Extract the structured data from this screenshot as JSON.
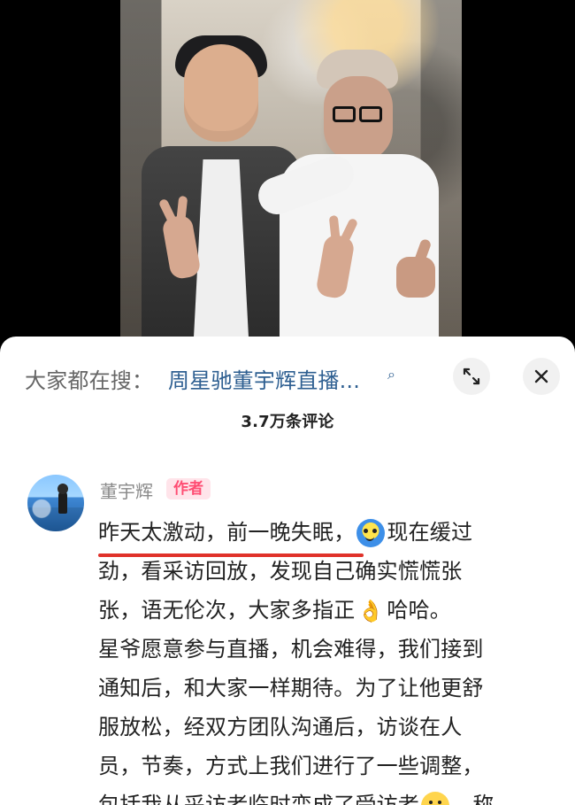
{
  "search": {
    "prefix": "大家都在搜：",
    "query": "周星驰董宇辉直播..."
  },
  "header": {
    "comment_count": "3.7万条评论"
  },
  "comment": {
    "username": "董宇辉",
    "author_tag": "作者",
    "line1a": "昨天太激动，前一晚失眠，",
    "line1b": "现在缓过",
    "line2": "劲，看采访回放，发现自己确实慌慌张",
    "line3a": "张，语无伦次，大家多指正",
    "line3b": "哈哈。",
    "line4": "星爷愿意参与直播，机会难得，我们接到",
    "line5": "通知后，和大家一样期待。为了让他更舒",
    "line6": "服放松，经双方团队沟通后，访谈在人",
    "line7": "员，节奏，方式上我们进行了一些调整，",
    "line8a": "包括我从采访者临时变成了受访者",
    "line8b": "，称"
  },
  "icons": {
    "search": "search-icon",
    "expand": "expand-icon",
    "close": "close-icon"
  },
  "colors": {
    "accent": "#2e5f91",
    "tag": "#ff4d73",
    "underline": "#e0322a"
  }
}
